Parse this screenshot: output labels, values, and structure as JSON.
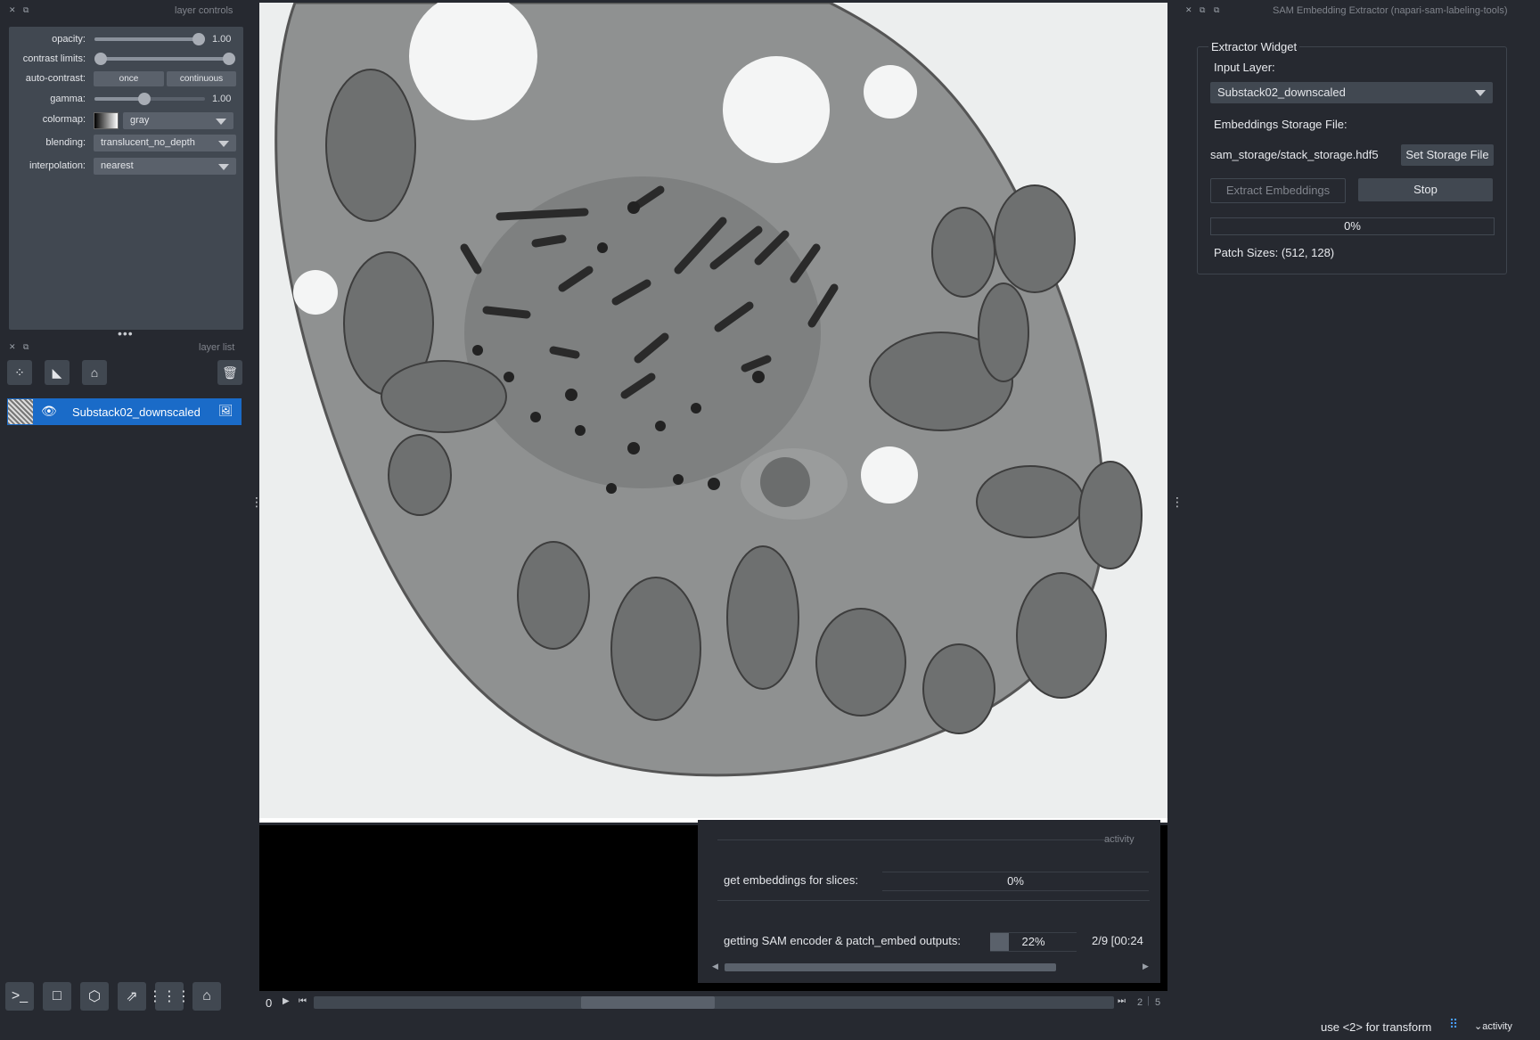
{
  "layer_controls": {
    "title": "layer controls",
    "opacity_label": "opacity:",
    "opacity_value": "1.00",
    "contrast_label": "contrast limits:",
    "autocontrast_label": "auto-contrast:",
    "once_label": "once",
    "continuous_label": "continuous",
    "gamma_label": "gamma:",
    "gamma_value": "1.00",
    "colormap_label": "colormap:",
    "colormap_value": "gray",
    "blending_label": "blending:",
    "blending_value": "translucent_no_depth",
    "interpolation_label": "interpolation:",
    "interpolation_value": "nearest"
  },
  "layer_list": {
    "title": "layer list",
    "layers": [
      {
        "name": "Substack02_downscaled",
        "visible": true,
        "selected": true
      }
    ]
  },
  "sam_widget": {
    "window_title": "SAM Embedding Extractor (napari-sam-labeling-tools)",
    "group_title": "Extractor Widget",
    "input_layer_label": "Input Layer:",
    "input_layer_value": "Substack02_downscaled",
    "storage_label": "Embeddings Storage File:",
    "storage_value": "sam_storage/stack_storage.hdf5",
    "set_storage_button": "Set Storage File",
    "extract_button": "Extract Embeddings",
    "stop_button": "Stop",
    "progress_text": "0%",
    "progress_fraction": 0.0,
    "patch_sizes": "Patch Sizes: (512, 128)"
  },
  "activity": {
    "title": "activity",
    "task1_label": "get embeddings for slices:",
    "task1_progress_text": "0%",
    "task1_fraction": 0.0,
    "task2_label": "getting SAM encoder & patch_embed outputs:",
    "task2_progress_text": "22%",
    "task2_fraction": 0.22,
    "task2_count": "2/9 [00:24"
  },
  "dims_slider": {
    "current": "0",
    "right_value": "2",
    "total": "5"
  },
  "status_bar": {
    "message": "use <2> for transform",
    "activity_label": "activity"
  },
  "colors": {
    "background": "#262930",
    "panel": "#414851",
    "selected": "#1a6bc8",
    "foreground": "#e4e6ea"
  }
}
